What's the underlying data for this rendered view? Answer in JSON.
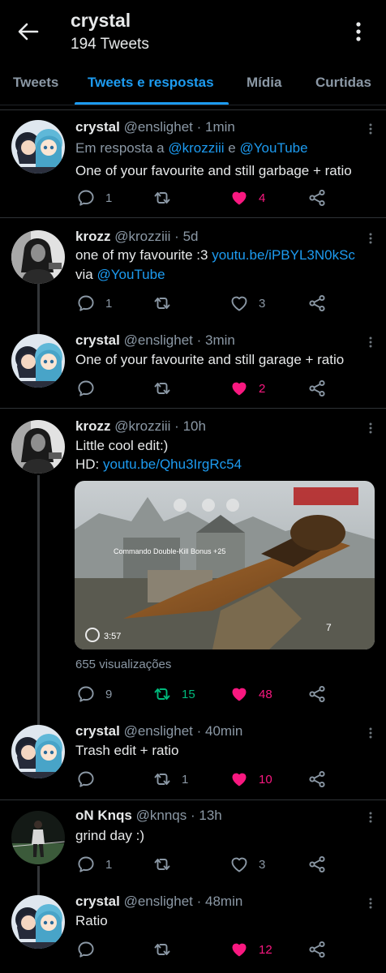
{
  "header": {
    "title": "crystal",
    "subtitle": "194 Tweets"
  },
  "tabs": [
    {
      "label": "Tweets",
      "active": false
    },
    {
      "label": "Tweets e respostas",
      "active": true
    },
    {
      "label": "Mídia",
      "active": false
    },
    {
      "label": "Curtidas",
      "active": false
    }
  ],
  "tweets": [
    {
      "name": "crystal",
      "handle": "@enslighet",
      "time": "1min",
      "reply_prefix": "Em resposta a",
      "reply_user1": "@krozziii",
      "reply_and": "e",
      "reply_user2": "@YouTube",
      "text": "One of your favourite and still garbage + ratio",
      "replies": "1",
      "retweets": "",
      "likes": "4"
    },
    {
      "name": "krozz",
      "handle": "@krozziii",
      "time": "5d",
      "text1": "one of my favourite :3",
      "link1": "youtu.be/iPBYL3N0kSc",
      "text2": "via",
      "link2": "@YouTube",
      "replies": "1",
      "retweets": "",
      "likes": "3"
    },
    {
      "name": "crystal",
      "handle": "@enslighet",
      "time": "3min",
      "text": "One of your favourite and still garage + ratio",
      "replies": "",
      "retweets": "",
      "likes": "2"
    },
    {
      "name": "krozz",
      "handle": "@krozziii",
      "time": "10h",
      "text1": "Little cool edit:)",
      "hd_label": "HD:",
      "link": "youtu.be/Qhu3IrgRc54",
      "video": {
        "score_left": "",
        "timer": "3:57",
        "kill_text": "Commando Double-Kill Bonus +25",
        "ammo": "7"
      },
      "views": "655 visualizações",
      "replies": "9",
      "retweets": "15",
      "likes": "48"
    },
    {
      "name": "crystal",
      "handle": "@enslighet",
      "time": "40min",
      "text": "Trash edit + ratio",
      "replies": "",
      "retweets": "1",
      "likes": "10"
    },
    {
      "name": "oN Knqs",
      "handle": "@knnqs",
      "time": "13h",
      "text": "grind day :)",
      "replies": "1",
      "retweets": "",
      "likes": "3"
    },
    {
      "name": "crystal",
      "handle": "@enslighet",
      "time": "48min",
      "text": "Ratio",
      "replies": "",
      "retweets": "",
      "likes": "12"
    }
  ],
  "separator": "·",
  "colors": {
    "background": "#000000",
    "accent": "#1d9bf0",
    "like": "#f91880",
    "retweet": "#00ba7c",
    "muted": "#8b98a5",
    "divider": "#2f3336"
  },
  "icons": {
    "back": "arrow-left-icon",
    "more": "vertical-dots-icon",
    "reply": "speech-bubble-icon",
    "retweet": "retweet-icon",
    "like": "heart-icon",
    "share": "share-icon"
  }
}
